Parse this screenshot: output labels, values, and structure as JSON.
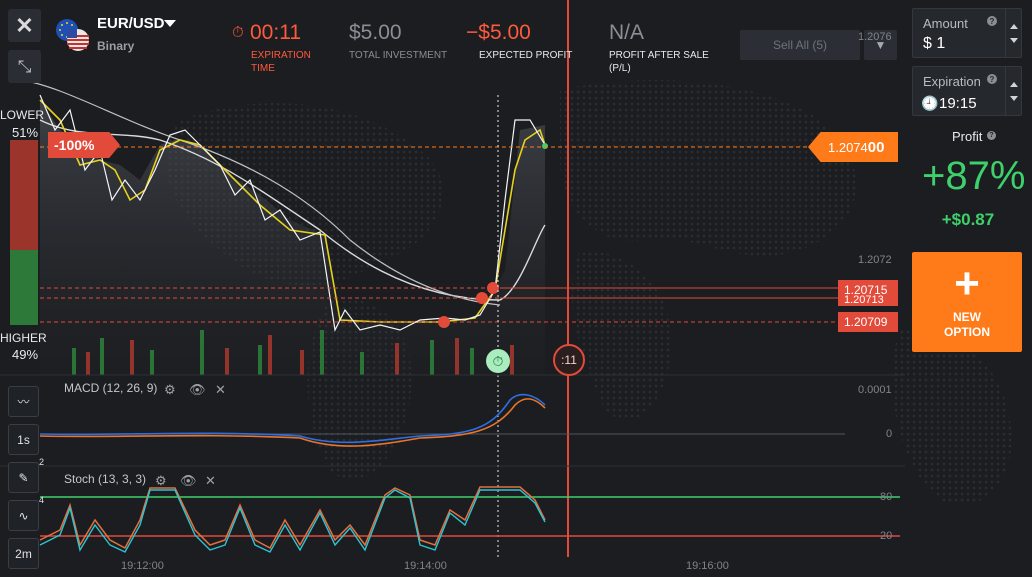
{
  "asset": {
    "name": "EUR/USD",
    "type": "Binary"
  },
  "stats": {
    "timer": {
      "value": "00:11",
      "label": "EXPIRATION TIME"
    },
    "investment": {
      "value": "$5.00",
      "label": "TOTAL INVESTMENT"
    },
    "expected": {
      "value": "−$5.00",
      "label": "EXPECTED PROFIT"
    },
    "after_sale": {
      "value": "N/A",
      "label": "PROFIT AFTER SALE (P/L)"
    }
  },
  "sell_all": "Sell All (5)",
  "amount": {
    "label": "Amount",
    "value": "$  1"
  },
  "expiration": {
    "label": "Expiration",
    "value": "19:15"
  },
  "profit": {
    "label": "Profit",
    "percent": "+87%",
    "amount": "+$0.87"
  },
  "new_option": "NEW OPTION",
  "sentiment": {
    "lower_label": "LOWER",
    "lower_pct": "51%",
    "higher_label": "HIGHER",
    "higher_pct": "49%"
  },
  "tags": {
    "loss_pct": "-100%",
    "current_price_main": "1.2074",
    "current_price_tail": "00",
    "deal1": "1.20715",
    "deal2": "1.20713",
    "deal3": "1.20709"
  },
  "price_axis": {
    "top": "1.2076",
    "mid": "1.2072"
  },
  "countdown": ":11",
  "indicators": {
    "macd": {
      "label": "MACD (12, 26, 9)",
      "tick_top": "0.0001",
      "tick_zero": "0"
    },
    "stoch": {
      "label": "Stoch (13, 3, 3)",
      "tick_80": "80",
      "tick_20": "20"
    }
  },
  "time_axis": [
    "19:12:00",
    "19:14:00",
    "19:16:00"
  ],
  "tools": {
    "timeframe": "1s",
    "draw_badge": "2",
    "ind_badge": "4",
    "period": "2m"
  },
  "colors": {
    "accent": "#ff7a18",
    "loss": "#e24a3a",
    "profit": "#3ed06a"
  }
}
